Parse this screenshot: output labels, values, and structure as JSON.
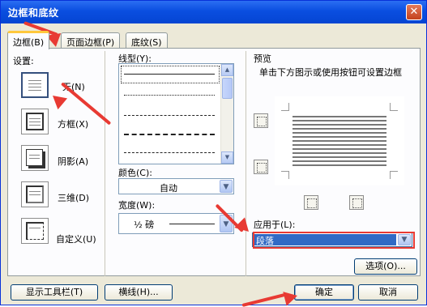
{
  "dialog": {
    "title": "边框和底纹",
    "close": "✕"
  },
  "tabs": [
    {
      "label": "边框(B)"
    },
    {
      "label": "页面边框(P)"
    },
    {
      "label": "底纹(S)"
    }
  ],
  "settings": {
    "heading": "设置:",
    "options": [
      {
        "label": "无(N)"
      },
      {
        "label": "方框(X)"
      },
      {
        "label": "阴影(A)"
      },
      {
        "label": "三维(D)"
      },
      {
        "label": "自定义(U)"
      }
    ]
  },
  "style": {
    "label": "线型(Y):"
  },
  "color": {
    "label": "颜色(C):",
    "value": "自动"
  },
  "width": {
    "label": "宽度(W):",
    "value": "½ 磅"
  },
  "preview": {
    "heading": "预览",
    "hint": "单击下方图示或使用按钮可设置边框"
  },
  "apply_to": {
    "label": "应用于(L):",
    "value": "段落"
  },
  "buttons": {
    "options": "选项(O)...",
    "toolbar": "显示工具栏(T)",
    "hline": "横线(H)...",
    "ok": "确定",
    "cancel": "取消"
  }
}
